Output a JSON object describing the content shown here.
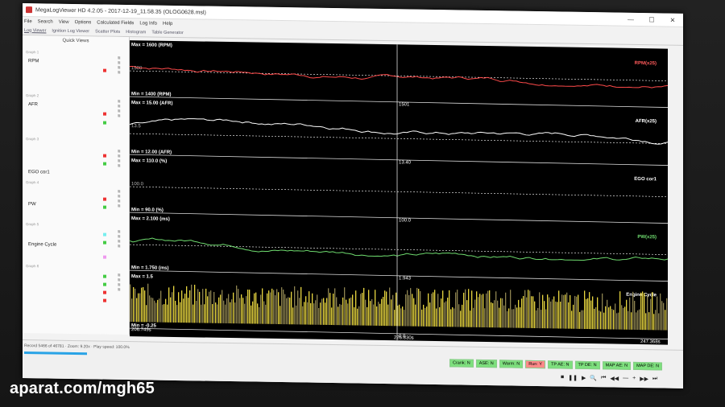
{
  "window": {
    "title": "MegaLogViewer HD 4.2.05 - 2017-12-19_11.58.35 (OLOG0628.msl)",
    "controls": [
      "—",
      "☐",
      "✕"
    ]
  },
  "menu": [
    "File",
    "Search",
    "View",
    "Options",
    "Calculated Fields",
    "Log Info",
    "Help"
  ],
  "tabs": [
    {
      "label": "Log Viewer",
      "active": true
    },
    {
      "label": "Ignition Log Viewer",
      "active": false
    },
    {
      "label": "Scatter Plots",
      "active": false
    },
    {
      "label": "Histogram",
      "active": false
    },
    {
      "label": "Table Generator",
      "active": false
    }
  ],
  "sidebar": {
    "heading": "Quick Views",
    "graphs": [
      {
        "label": "Graph 1",
        "field": "RPM"
      },
      {
        "label": "Graph 2",
        "field": "AFR"
      },
      {
        "label": "Graph 3",
        "field": "EGO cor1"
      },
      {
        "label": "Graph 4",
        "field": "PW"
      },
      {
        "label": "Graph 5",
        "field": "Engine Cycle"
      },
      {
        "label": "Graph 6",
        "field": ""
      }
    ]
  },
  "chart_data": [
    {
      "type": "line",
      "name": "RPM(x25)",
      "max_label": "Max = 1600 (RPM)",
      "min_label": "Min = 1400 (RPM)",
      "ylim": [
        1400,
        1600
      ],
      "ref_label": "1500",
      "cursor_value": "1501",
      "color": "#ff4a4a"
    },
    {
      "type": "line",
      "name": "AFR(x25)",
      "max_label": "Max = 15.00 (AFR)",
      "min_label": "Min = 12.00 (AFR)",
      "ylim": [
        12.0,
        15.0
      ],
      "ref_label": "13.5",
      "cursor_value": "13.40",
      "color": "#ffffff"
    },
    {
      "type": "line",
      "name": "EGO cor1",
      "max_label": "Max = 110.0 (%)",
      "min_label": "Min = 90.0 (%)",
      "ylim": [
        90.0,
        110.0
      ],
      "ref_label": "100.0",
      "cursor_value": "100.0",
      "color": "#ffffff"
    },
    {
      "type": "line",
      "name": "PW(x25)",
      "max_label": "Max = 2.100 (ms)",
      "min_label": "Min = 1.750 (ms)",
      "ylim": [
        1.75,
        2.1
      ],
      "ref_label": "",
      "cursor_value": "1.943",
      "color": "#6fdc6f"
    },
    {
      "type": "bar",
      "name": "Engine Cycle",
      "max_label": "Max = 1.5",
      "min_label": "Min = -0.25",
      "ylim": [
        -0.25,
        1.5
      ],
      "cursor_value": "0.0",
      "color": "#e8d640"
    }
  ],
  "timeline": {
    "start": "206.749s",
    "cursor": "226.830s",
    "end": "247.368s"
  },
  "status": {
    "record_info": "Record 5466 of 46781 · Zoom: 9.20x · Play speed: 100.0%",
    "progress_fraction": 0.12,
    "flags": [
      {
        "label": "Crank: N",
        "color": "#7ee07e"
      },
      {
        "label": "ASE: N",
        "color": "#7ee07e"
      },
      {
        "label": "Warm: N",
        "color": "#7ee07e"
      },
      {
        "label": "Run: Y",
        "color": "#ff8a8a"
      },
      {
        "label": "TP AE: N",
        "color": "#7ee07e"
      },
      {
        "label": "TP DE: N",
        "color": "#7ee07e"
      },
      {
        "label": "MAP AE: N",
        "color": "#7ee07e"
      },
      {
        "label": "MAP DE: N",
        "color": "#7ee07e"
      }
    ],
    "playback": [
      "■",
      "❚❚",
      "▶",
      "🔍",
      "⏮",
      "◀◀",
      "—",
      "+",
      "▶▶",
      "⏭"
    ]
  },
  "watermark": "aparat.com/mgh65"
}
